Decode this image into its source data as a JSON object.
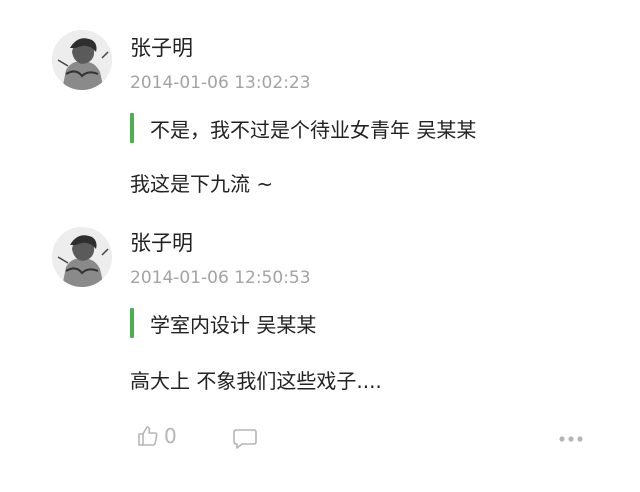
{
  "comments": [
    {
      "author": "张子明",
      "timestamp": "2014-01-06 13:02:23",
      "quote": "不是，我不过是个待业女青年 吴某某",
      "reply": "我这是下九流 ~"
    },
    {
      "author": "张子明",
      "timestamp": "2014-01-06 12:50:53",
      "quote": "学室内设计 吴某某",
      "reply": "高大上 不象我们这些戏子...."
    }
  ],
  "actions": {
    "like_icon": "thumbs-up-icon",
    "like_count": "0",
    "comment_icon": "comment-bubble-icon",
    "more_icon": "more-dots-icon"
  },
  "colors": {
    "quote_bar": "#4caf50",
    "timestamp": "#a3a3a3",
    "icon": "#b5b5b5"
  }
}
